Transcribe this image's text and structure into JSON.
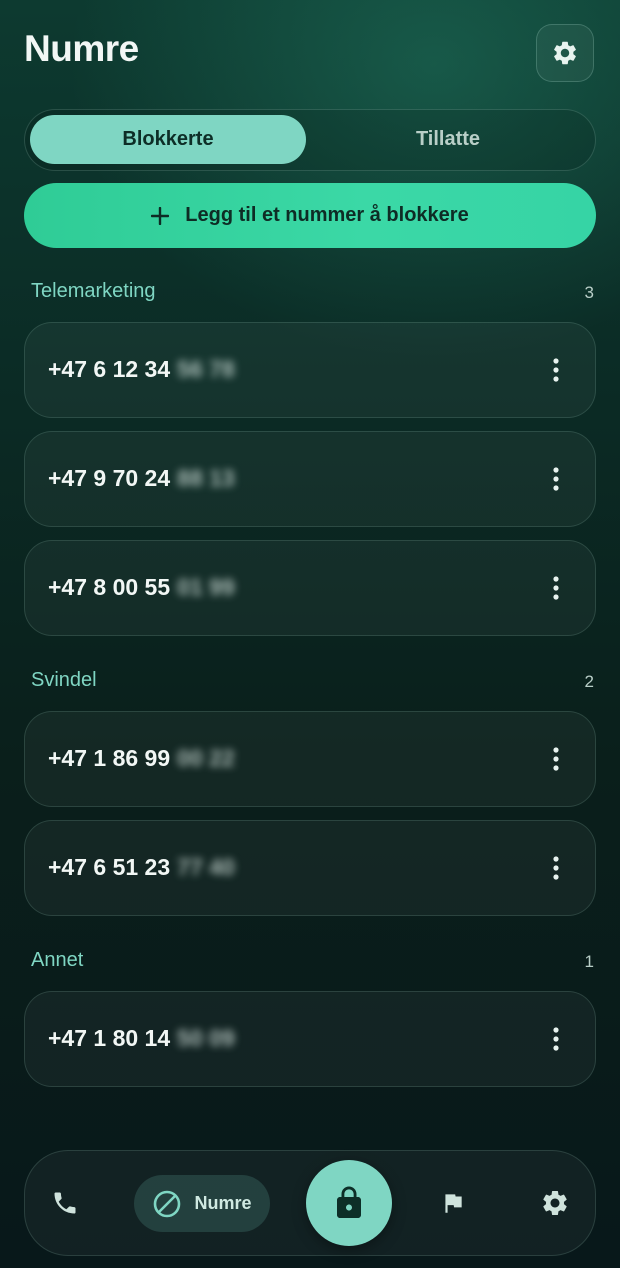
{
  "header": {
    "title": "Numre",
    "settings_icon": "gear-icon"
  },
  "tabs": [
    {
      "label": "Blokkerte",
      "active": true
    },
    {
      "label": "Tillatte",
      "active": false
    }
  ],
  "add_button": {
    "icon": "plus-icon",
    "label": "Legg til et nummer å blokkere"
  },
  "sections": [
    {
      "title": "Telemarketing",
      "count": "3",
      "numbers": [
        {
          "visible": "+47 6 12 34",
          "hidden": "56 78"
        },
        {
          "visible": "+47 9 70 24",
          "hidden": "88 13"
        },
        {
          "visible": "+47 8 00 55",
          "hidden": "01 99"
        }
      ]
    },
    {
      "title": "Svindel",
      "count": "2",
      "numbers": [
        {
          "visible": "+47 1 86 99",
          "hidden": "00 22"
        },
        {
          "visible": "+47 6 51 23",
          "hidden": "77 40"
        }
      ]
    },
    {
      "title": "Annet",
      "count": "1",
      "numbers": [
        {
          "visible": "+47 1 80 14",
          "hidden": "50 09"
        }
      ]
    }
  ],
  "nav": {
    "items": [
      {
        "icon": "phone-icon"
      },
      {
        "icon": "block-icon",
        "label": "Numre",
        "active": true
      },
      {
        "icon": "lock-icon"
      },
      {
        "icon": "flag-icon"
      },
      {
        "icon": "gear-icon"
      }
    ]
  },
  "colors": {
    "accent": "#7fd6c3",
    "button": "#36d4a0",
    "background": "#0a2622"
  }
}
